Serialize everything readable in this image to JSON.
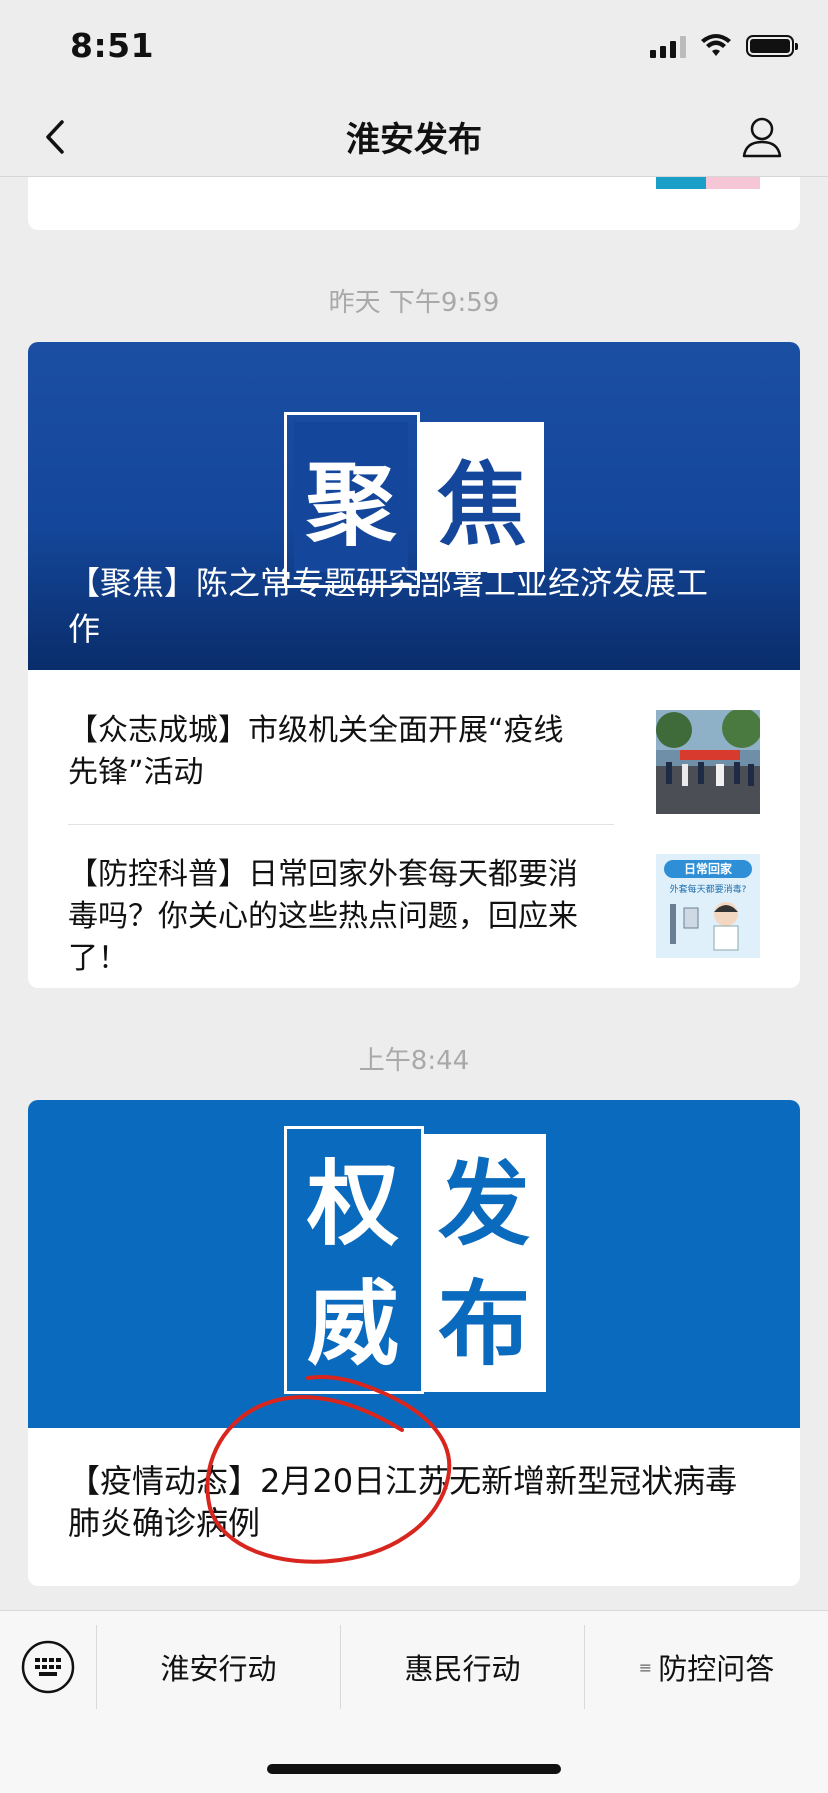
{
  "status_bar": {
    "time": "8:51"
  },
  "nav": {
    "title": "淮安发布"
  },
  "messages": [
    {
      "timestamp": "昨天 下午9:59",
      "hero": {
        "tile_left": "聚",
        "tile_right": "焦",
        "title": "【聚焦】陈之常专题研究部署工业经济发展工作"
      },
      "items": [
        {
          "title": "【众志成城】市级机关全面开展“疫线先锋”活动"
        },
        {
          "title": "【防控科普】日常回家外套每天都要消毒吗？你关心的这些热点问题，回应来了！",
          "thumb_text_1": "日常回家",
          "thumb_text_2": "外套每天都要消毒?"
        }
      ]
    },
    {
      "timestamp": "上午8:44",
      "hero": {
        "tile_left_top": "权",
        "tile_left_bottom": "威",
        "tile_right_top": "发",
        "tile_right_bottom": "布"
      },
      "items": [
        {
          "title": "【疫情动态】2月20日江苏无新增新型冠状病毒肺炎确诊病例"
        }
      ]
    }
  ],
  "menu": {
    "items": [
      {
        "label": "淮安行动"
      },
      {
        "label": "惠民行动"
      },
      {
        "label": "防控问答"
      }
    ]
  },
  "colors": {
    "hero1": "#14479b",
    "hero2": "#0a6abd",
    "annotation": "#d8261e"
  }
}
